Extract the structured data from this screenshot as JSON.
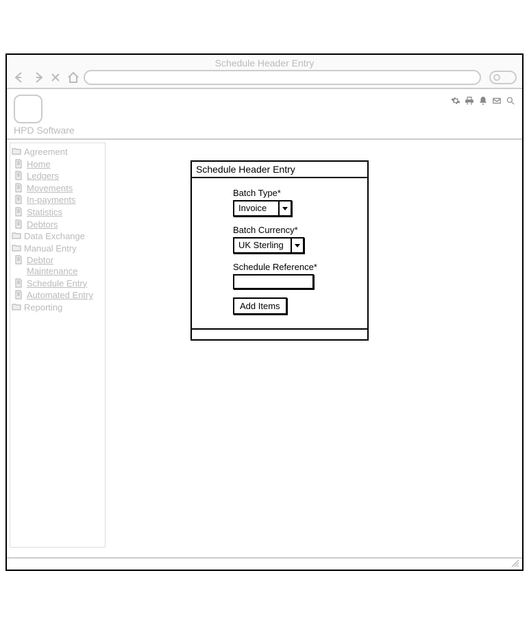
{
  "browser": {
    "title": "Schedule Header Entry"
  },
  "app": {
    "name": "HPD Software"
  },
  "sidebar": {
    "items": [
      {
        "type": "folder",
        "label": "Agreement",
        "link": false
      },
      {
        "type": "doc",
        "label": "Home",
        "link": true
      },
      {
        "type": "doc",
        "label": "Ledgers",
        "link": true
      },
      {
        "type": "doc",
        "label": "Movements",
        "link": true
      },
      {
        "type": "doc",
        "label": "In-payments",
        "link": true
      },
      {
        "type": "doc",
        "label": "Statistics",
        "link": true
      },
      {
        "type": "doc",
        "label": "Debtors",
        "link": true
      },
      {
        "type": "folder",
        "label": "Data Exchange",
        "link": false
      },
      {
        "type": "folder",
        "label": "Manual Entry",
        "link": false
      },
      {
        "type": "doc",
        "label": "Debtor Maintenance",
        "link": true
      },
      {
        "type": "doc",
        "label": "Schedule Entry",
        "link": true
      },
      {
        "type": "doc",
        "label": "Automated Entry",
        "link": true
      },
      {
        "type": "folder",
        "label": "Reporting",
        "link": false
      }
    ]
  },
  "form": {
    "title": "Schedule Header Entry",
    "batch_type_label": "Batch Type*",
    "batch_type_value": "Invoice",
    "batch_currency_label": "Batch Currency*",
    "batch_currency_value": "UK Sterling",
    "schedule_ref_label": "Schedule Reference*",
    "schedule_ref_value": "",
    "add_items_label": "Add Items"
  }
}
